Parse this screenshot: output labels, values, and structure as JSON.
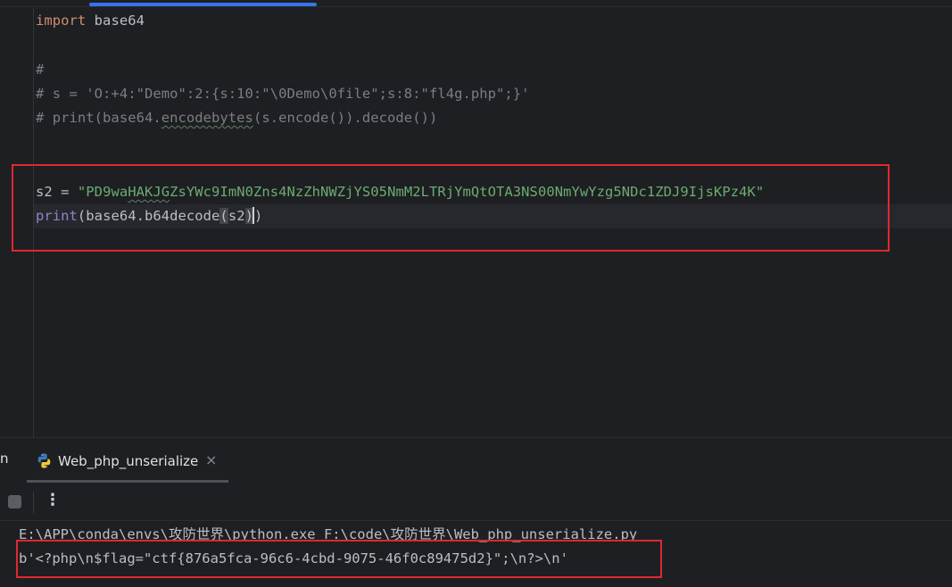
{
  "editor": {
    "lines": {
      "l1_kw": "import",
      "l1_rest": " base64",
      "l2": "#",
      "l3": "# s = 'O:+4:\"Demo\":2:{s:10:\"\\0Demo\\0file\";s:8:\"fl4g.php\";}'",
      "l4_a": "# print(base64.",
      "l4_b": "encodebytes",
      "l4_c": "(s.encode()).decode())",
      "l5_var": "s2 = ",
      "l5_str_a": "\"PD9wa",
      "l5_str_b": "HAKJG",
      "l5_str_c": "ZsYWc9ImN0Zns4NzZhNWZjYS05NmM2LTRjYmQtOTA3NS00NmYwYzg5NDc1ZDJ9IjsKPz4K\"",
      "l6_fn": "print",
      "l6_a": "(base64.b64decode",
      "l6_paren_open": "(",
      "l6_arg": "s2",
      "l6_paren_close": ")",
      "l6_end": ")"
    }
  },
  "run_panel": {
    "truncated_tab": "n",
    "tab_label": "Web_php_unserialize",
    "close_symbol": "×",
    "more_symbol": "⋮"
  },
  "console": {
    "command": "E:\\APP\\conda\\envs\\攻防世界\\python.exe F:\\code\\攻防世界\\Web_php_unserialize.py",
    "output": "b'<?php\\n$flag=\"ctf{876a5fca-96c6-4cbd-9075-46f0c89475d2}\";\\n?>\\n'"
  },
  "colors": {
    "keyword": "#cf8e6d",
    "comment": "#7a7e85",
    "string": "#6aab73",
    "highlight_box": "#e0282c",
    "background": "#1e1f22"
  }
}
